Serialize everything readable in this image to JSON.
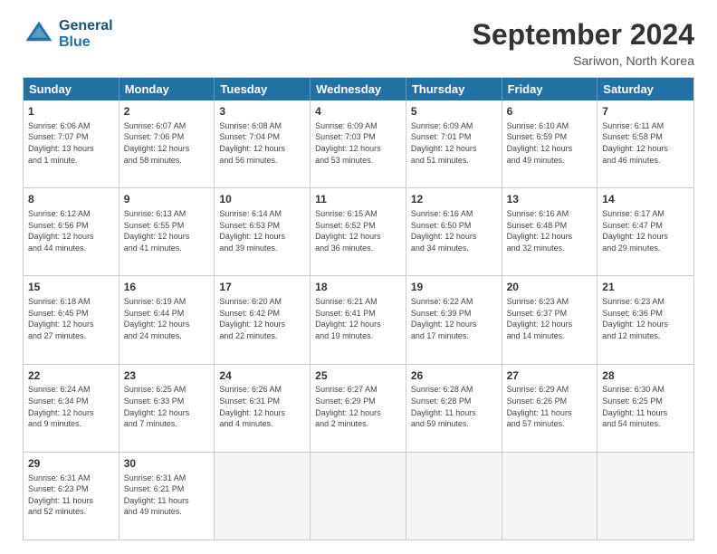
{
  "logo": {
    "line1": "General",
    "line2": "Blue"
  },
  "title": "September 2024",
  "subtitle": "Sariwon, North Korea",
  "header_days": [
    "Sunday",
    "Monday",
    "Tuesday",
    "Wednesday",
    "Thursday",
    "Friday",
    "Saturday"
  ],
  "rows": [
    [
      {
        "day": "1",
        "lines": [
          "Sunrise: 6:06 AM",
          "Sunset: 7:07 PM",
          "Daylight: 13 hours",
          "and 1 minute."
        ]
      },
      {
        "day": "2",
        "lines": [
          "Sunrise: 6:07 AM",
          "Sunset: 7:06 PM",
          "Daylight: 12 hours",
          "and 58 minutes."
        ]
      },
      {
        "day": "3",
        "lines": [
          "Sunrise: 6:08 AM",
          "Sunset: 7:04 PM",
          "Daylight: 12 hours",
          "and 56 minutes."
        ]
      },
      {
        "day": "4",
        "lines": [
          "Sunrise: 6:09 AM",
          "Sunset: 7:03 PM",
          "Daylight: 12 hours",
          "and 53 minutes."
        ]
      },
      {
        "day": "5",
        "lines": [
          "Sunrise: 6:09 AM",
          "Sunset: 7:01 PM",
          "Daylight: 12 hours",
          "and 51 minutes."
        ]
      },
      {
        "day": "6",
        "lines": [
          "Sunrise: 6:10 AM",
          "Sunset: 6:59 PM",
          "Daylight: 12 hours",
          "and 49 minutes."
        ]
      },
      {
        "day": "7",
        "lines": [
          "Sunrise: 6:11 AM",
          "Sunset: 6:58 PM",
          "Daylight: 12 hours",
          "and 46 minutes."
        ]
      }
    ],
    [
      {
        "day": "8",
        "lines": [
          "Sunrise: 6:12 AM",
          "Sunset: 6:56 PM",
          "Daylight: 12 hours",
          "and 44 minutes."
        ]
      },
      {
        "day": "9",
        "lines": [
          "Sunrise: 6:13 AM",
          "Sunset: 6:55 PM",
          "Daylight: 12 hours",
          "and 41 minutes."
        ]
      },
      {
        "day": "10",
        "lines": [
          "Sunrise: 6:14 AM",
          "Sunset: 6:53 PM",
          "Daylight: 12 hours",
          "and 39 minutes."
        ]
      },
      {
        "day": "11",
        "lines": [
          "Sunrise: 6:15 AM",
          "Sunset: 6:52 PM",
          "Daylight: 12 hours",
          "and 36 minutes."
        ]
      },
      {
        "day": "12",
        "lines": [
          "Sunrise: 6:16 AM",
          "Sunset: 6:50 PM",
          "Daylight: 12 hours",
          "and 34 minutes."
        ]
      },
      {
        "day": "13",
        "lines": [
          "Sunrise: 6:16 AM",
          "Sunset: 6:48 PM",
          "Daylight: 12 hours",
          "and 32 minutes."
        ]
      },
      {
        "day": "14",
        "lines": [
          "Sunrise: 6:17 AM",
          "Sunset: 6:47 PM",
          "Daylight: 12 hours",
          "and 29 minutes."
        ]
      }
    ],
    [
      {
        "day": "15",
        "lines": [
          "Sunrise: 6:18 AM",
          "Sunset: 6:45 PM",
          "Daylight: 12 hours",
          "and 27 minutes."
        ]
      },
      {
        "day": "16",
        "lines": [
          "Sunrise: 6:19 AM",
          "Sunset: 6:44 PM",
          "Daylight: 12 hours",
          "and 24 minutes."
        ]
      },
      {
        "day": "17",
        "lines": [
          "Sunrise: 6:20 AM",
          "Sunset: 6:42 PM",
          "Daylight: 12 hours",
          "and 22 minutes."
        ]
      },
      {
        "day": "18",
        "lines": [
          "Sunrise: 6:21 AM",
          "Sunset: 6:41 PM",
          "Daylight: 12 hours",
          "and 19 minutes."
        ]
      },
      {
        "day": "19",
        "lines": [
          "Sunrise: 6:22 AM",
          "Sunset: 6:39 PM",
          "Daylight: 12 hours",
          "and 17 minutes."
        ]
      },
      {
        "day": "20",
        "lines": [
          "Sunrise: 6:23 AM",
          "Sunset: 6:37 PM",
          "Daylight: 12 hours",
          "and 14 minutes."
        ]
      },
      {
        "day": "21",
        "lines": [
          "Sunrise: 6:23 AM",
          "Sunset: 6:36 PM",
          "Daylight: 12 hours",
          "and 12 minutes."
        ]
      }
    ],
    [
      {
        "day": "22",
        "lines": [
          "Sunrise: 6:24 AM",
          "Sunset: 6:34 PM",
          "Daylight: 12 hours",
          "and 9 minutes."
        ]
      },
      {
        "day": "23",
        "lines": [
          "Sunrise: 6:25 AM",
          "Sunset: 6:33 PM",
          "Daylight: 12 hours",
          "and 7 minutes."
        ]
      },
      {
        "day": "24",
        "lines": [
          "Sunrise: 6:26 AM",
          "Sunset: 6:31 PM",
          "Daylight: 12 hours",
          "and 4 minutes."
        ]
      },
      {
        "day": "25",
        "lines": [
          "Sunrise: 6:27 AM",
          "Sunset: 6:29 PM",
          "Daylight: 12 hours",
          "and 2 minutes."
        ]
      },
      {
        "day": "26",
        "lines": [
          "Sunrise: 6:28 AM",
          "Sunset: 6:28 PM",
          "Daylight: 11 hours",
          "and 59 minutes."
        ]
      },
      {
        "day": "27",
        "lines": [
          "Sunrise: 6:29 AM",
          "Sunset: 6:26 PM",
          "Daylight: 11 hours",
          "and 57 minutes."
        ]
      },
      {
        "day": "28",
        "lines": [
          "Sunrise: 6:30 AM",
          "Sunset: 6:25 PM",
          "Daylight: 11 hours",
          "and 54 minutes."
        ]
      }
    ],
    [
      {
        "day": "29",
        "lines": [
          "Sunrise: 6:31 AM",
          "Sunset: 6:23 PM",
          "Daylight: 11 hours",
          "and 52 minutes."
        ]
      },
      {
        "day": "30",
        "lines": [
          "Sunrise: 6:31 AM",
          "Sunset: 6:21 PM",
          "Daylight: 11 hours",
          "and 49 minutes."
        ]
      },
      {
        "day": "",
        "lines": [],
        "empty": true
      },
      {
        "day": "",
        "lines": [],
        "empty": true
      },
      {
        "day": "",
        "lines": [],
        "empty": true
      },
      {
        "day": "",
        "lines": [],
        "empty": true
      },
      {
        "day": "",
        "lines": [],
        "empty": true
      }
    ]
  ]
}
